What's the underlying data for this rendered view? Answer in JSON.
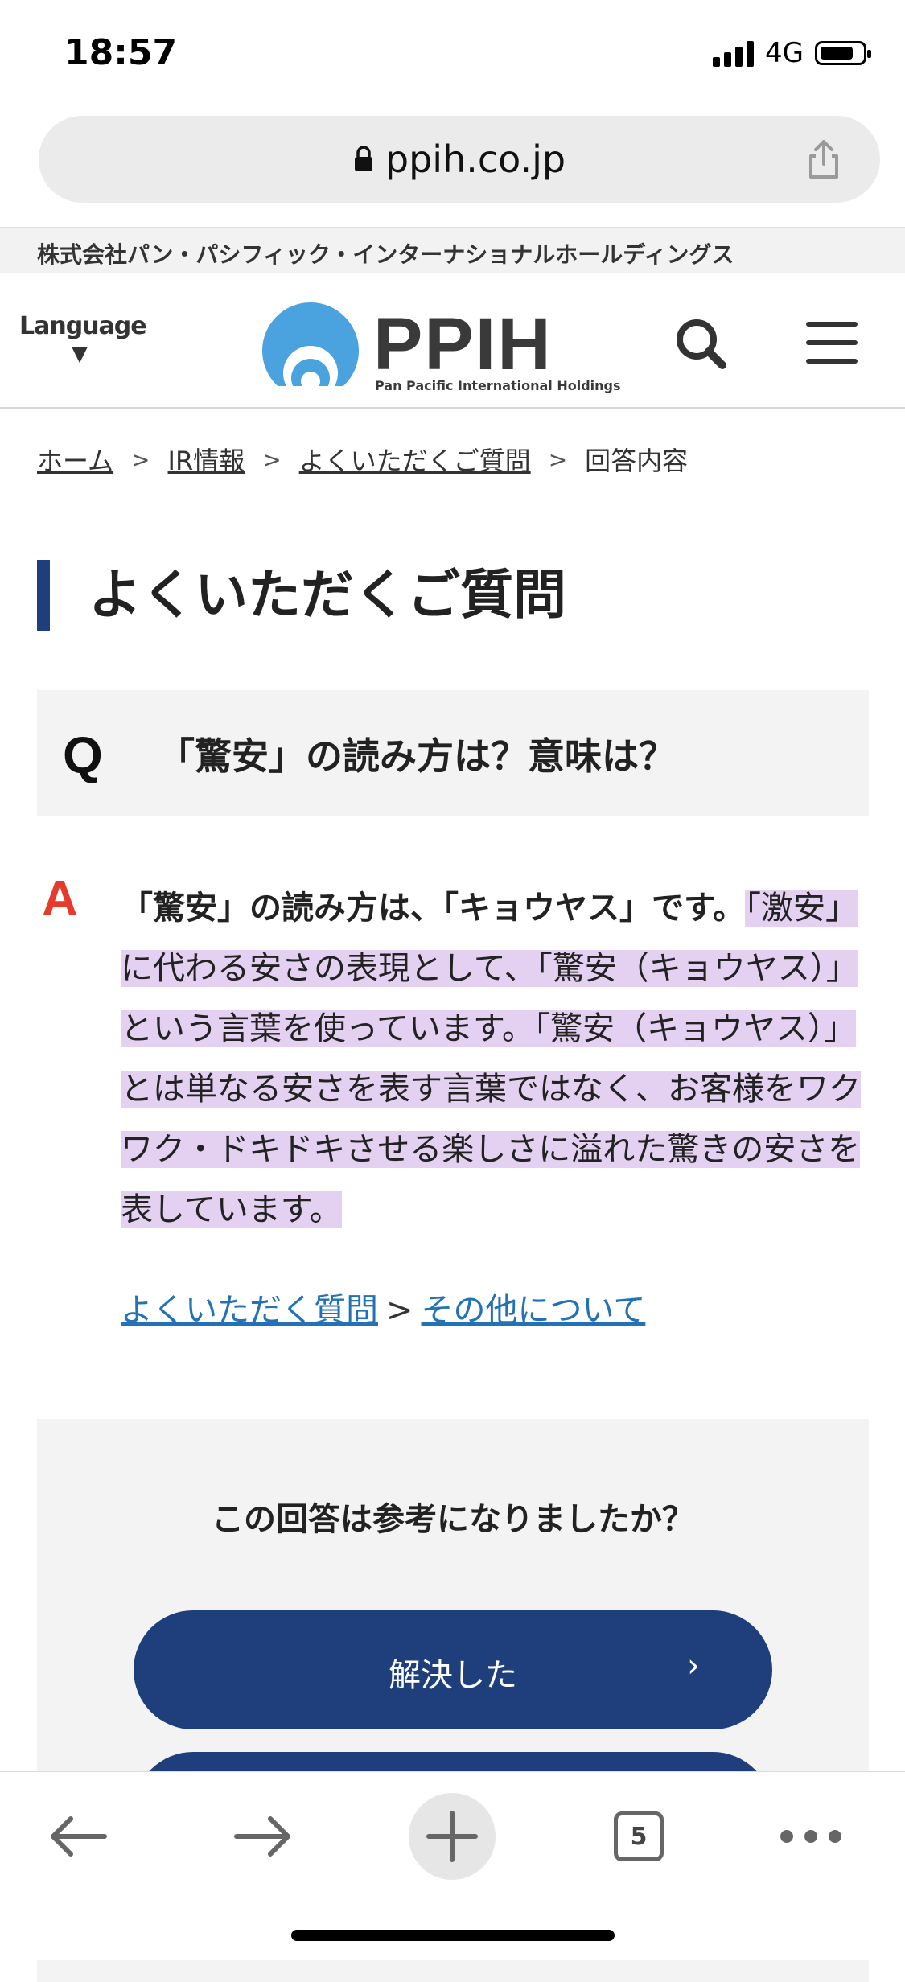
{
  "status_bar": {
    "time": "18:57",
    "network": "4G"
  },
  "browser": {
    "url": "ppih.co.jp",
    "tab_count": "5"
  },
  "site": {
    "company_name": "株式会社パン・パシフィック・インターナショナルホールディングス",
    "language_label": "Language",
    "language_arrow": "▼",
    "logo_text": "PPIH",
    "logo_subtitle": "Pan Pacific International Holdings",
    "brand_color": "#1e3f7c"
  },
  "breadcrumb": {
    "items": [
      "ホーム",
      "IR情報",
      "よくいただくご質問"
    ],
    "current": "回答内容",
    "separator": ">"
  },
  "page_title": "よくいただくご質問",
  "question": {
    "mark": "Q",
    "text": "「驚安」の読み方は？意味は？"
  },
  "answer": {
    "mark": "A",
    "lead": "「驚安」の読み方は、「キョウヤス」です。",
    "highlight": "「激安」に代わる安さの表現として、「驚安（キョウヤス）」という言葉を使っています。「驚安（キョウヤス）」とは単なる安さを表す言葉ではなく、お客様をワクワク・ドキドキさせる楽しさに溢れた驚きの安さを表しています。",
    "highlight_color": "#e4d1f2"
  },
  "related_links": {
    "primary": "よくいただく質問",
    "separator": ">",
    "secondary": "その他について"
  },
  "feedback": {
    "question": "この回答は参考になりましたか？",
    "resolved_label": "解決した",
    "chevron": "›"
  },
  "icons": [
    "lock-icon",
    "share-icon",
    "search-icon",
    "menu-icon",
    "back-arrow-icon",
    "forward-arrow-icon",
    "plus-icon",
    "more-icon"
  ]
}
